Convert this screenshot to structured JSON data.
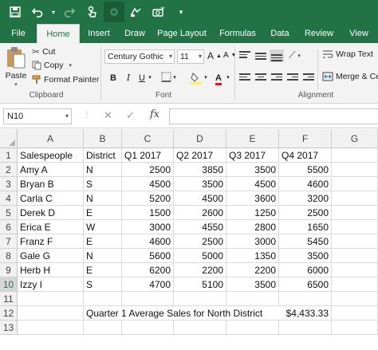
{
  "colors": {
    "brand": "#217346",
    "font_color_red": "#e81123",
    "fill_yellow": "#ffff00"
  },
  "qat": {
    "icons": [
      "save-icon",
      "undo-icon",
      "undo-dropdown",
      "redo-icon",
      "touch-mode-icon",
      "app-icon",
      "sync-icon",
      "camera-icon",
      "customize-icon"
    ]
  },
  "tabs": [
    "File",
    "Home",
    "Insert",
    "Draw",
    "Page Layout",
    "Formulas",
    "Data",
    "Review",
    "View"
  ],
  "active_tab": "Home",
  "ribbon": {
    "clipboard": {
      "paste": "Paste",
      "cut": "Cut",
      "copy": "Copy",
      "format_painter": "Format Painter",
      "label": "Clipboard"
    },
    "font": {
      "name": "Century Gothic",
      "size": "11",
      "bold": "B",
      "italic": "I",
      "underline": "U",
      "label": "Font",
      "grow": "A",
      "shrink": "A",
      "font_color": "A"
    },
    "alignment": {
      "wrap_text": "Wrap Text",
      "merge": "Merge & Ce",
      "label": "Alignment"
    }
  },
  "formula_bar": {
    "name_box": "N10",
    "cancel": "✕",
    "enter": "✓",
    "fx": "fx",
    "formula": ""
  },
  "columns": [
    "A",
    "B",
    "C",
    "D",
    "E",
    "F",
    "G"
  ],
  "rows": [
    {
      "num": "1",
      "cells": [
        "Salespeople",
        "District",
        "Q1 2017",
        "Q2 2017",
        "Q3 2017",
        "Q4 2017",
        ""
      ]
    },
    {
      "num": "2",
      "cells": [
        "Amy A",
        "N",
        "2500",
        "3850",
        "3500",
        "5500",
        ""
      ]
    },
    {
      "num": "3",
      "cells": [
        "Bryan B",
        "S",
        "4500",
        "3500",
        "4500",
        "4600",
        ""
      ]
    },
    {
      "num": "4",
      "cells": [
        "Carla C",
        "N",
        "5200",
        "4500",
        "3600",
        "3200",
        ""
      ]
    },
    {
      "num": "5",
      "cells": [
        "Derek D",
        "E",
        "1500",
        "2600",
        "1250",
        "2500",
        ""
      ]
    },
    {
      "num": "6",
      "cells": [
        "Erica E",
        "W",
        "3000",
        "4550",
        "2800",
        "1650",
        ""
      ]
    },
    {
      "num": "7",
      "cells": [
        "Franz F",
        "E",
        "4600",
        "2500",
        "3000",
        "5450",
        ""
      ]
    },
    {
      "num": "8",
      "cells": [
        "Gale G",
        "N",
        "5600",
        "5000",
        "1350",
        "3500",
        ""
      ]
    },
    {
      "num": "9",
      "cells": [
        "Herb H",
        "E",
        "6200",
        "2200",
        "2200",
        "6000",
        ""
      ]
    },
    {
      "num": "10",
      "cells": [
        "Izzy I",
        "S",
        "4700",
        "5100",
        "3500",
        "6500",
        ""
      ]
    },
    {
      "num": "11",
      "cells": [
        "",
        "",
        "",
        "",
        "",
        "",
        ""
      ]
    },
    {
      "num": "12",
      "cells": [
        "",
        "Quarter 1 Average Sales for North District",
        "",
        "",
        "",
        "$4,433.33",
        ""
      ]
    },
    {
      "num": "13",
      "cells": [
        "",
        "",
        "",
        "",
        "",
        "",
        ""
      ]
    }
  ],
  "selected_row": "10"
}
